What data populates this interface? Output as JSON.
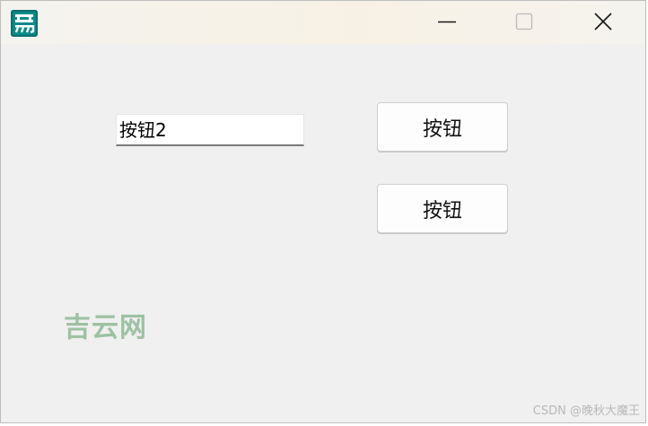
{
  "window": {
    "icon": "app-logo-icon",
    "controls": {
      "minimize_icon": "minimize-icon",
      "maximize_icon": "maximize-icon",
      "close_icon": "close-icon"
    }
  },
  "form": {
    "text_field_value": "按钮2",
    "button_1_label": "按钮",
    "button_2_label": "按钮"
  },
  "overlay": {
    "watermark_logo": "吉云网",
    "credit": "CSDN @晚秋大魔王"
  },
  "colors": {
    "icon_teal": "#0a8b88",
    "watermark_green": "#9dc2a2",
    "window_bg": "#f0f0f0"
  }
}
